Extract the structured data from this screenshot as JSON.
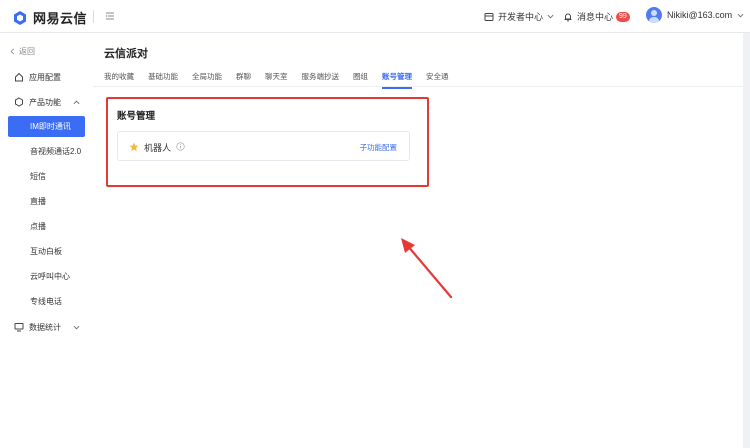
{
  "brand": {
    "name": "网易云信"
  },
  "header": {
    "dev_center": "开发者中心",
    "msg_center": "消息中心",
    "msg_badge": "99",
    "user_email": "Nikiki@163.com"
  },
  "sidebar": {
    "back_label": "返回",
    "items": [
      {
        "label": "应用配置"
      },
      {
        "label": "产品功能"
      }
    ],
    "sub_items": [
      {
        "label": "IM即时通讯"
      },
      {
        "label": "音视频通话2.0"
      },
      {
        "label": "短信"
      },
      {
        "label": "直播"
      },
      {
        "label": "点播"
      },
      {
        "label": "互动白板"
      },
      {
        "label": "云呼叫中心"
      },
      {
        "label": "专线电话"
      }
    ],
    "stats_label": "数据统计"
  },
  "main": {
    "title": "云信派对",
    "tabs": [
      "我的收藏",
      "基础功能",
      "全局功能",
      "群聊",
      "聊天室",
      "服务端抄送",
      "圈组",
      "账号管理",
      "安全通"
    ],
    "active_tab": "账号管理",
    "section_title": "账号管理",
    "card": {
      "name": "机器人",
      "link": "子功能配置"
    }
  },
  "colors": {
    "accent": "#3b6df4",
    "highlight": "#e53935",
    "star": "#f5b840"
  }
}
